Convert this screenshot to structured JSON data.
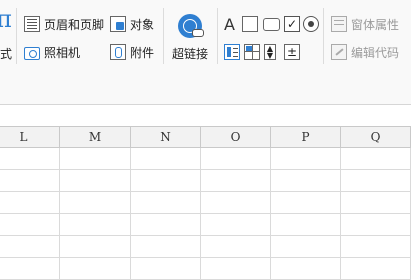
{
  "ribbon": {
    "partial_label": "式",
    "header_footer": "页眉和页脚",
    "object": "对象",
    "camera": "照相机",
    "attachment": "附件",
    "hyperlink": "超链接",
    "text_a": "A",
    "window_properties": "窗体属性",
    "edit_code": "编辑代码"
  },
  "columns": [
    "L",
    "M",
    "N",
    "O",
    "P",
    "Q"
  ],
  "colors": {
    "accent": "#2f7fd1",
    "grid_line": "#dadada",
    "header_bg": "#f2f2f2"
  }
}
